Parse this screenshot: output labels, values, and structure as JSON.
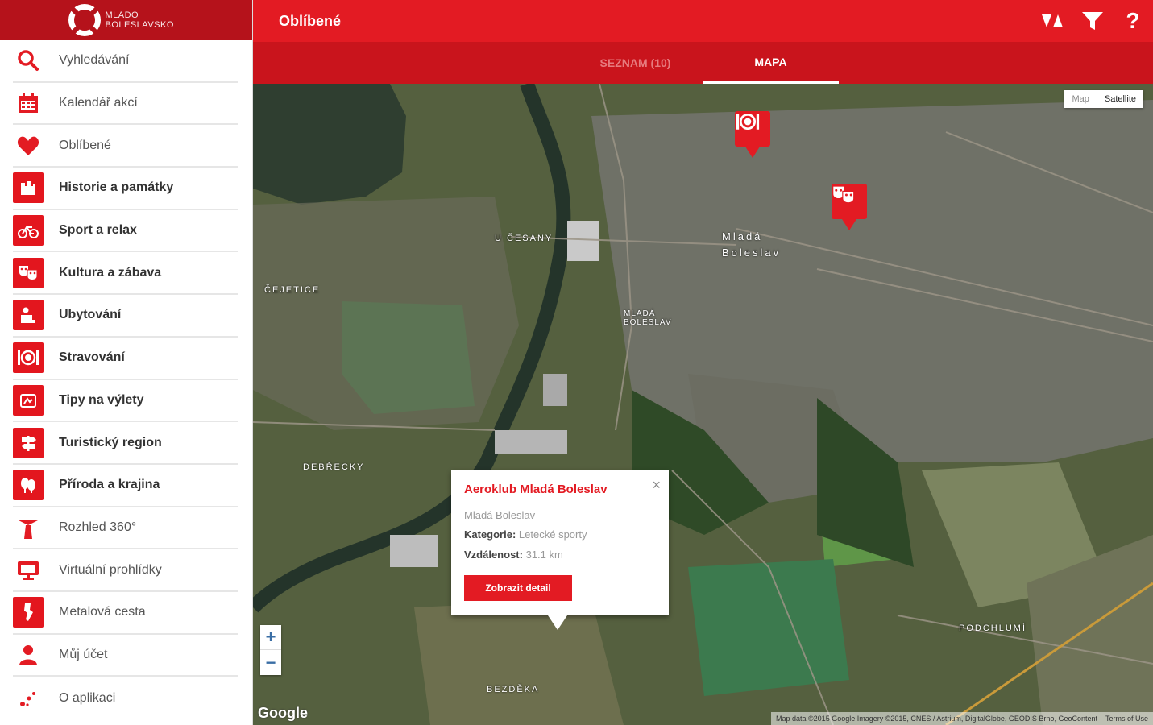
{
  "brand": {
    "name": "MLADO BOLESLAVSKO"
  },
  "header": {
    "title": "Oblíbené",
    "help_label": "?"
  },
  "tabs": [
    {
      "label": "SEZNAM (10)",
      "active": false
    },
    {
      "label": "MAPA",
      "active": true
    }
  ],
  "sidebar": {
    "items": [
      {
        "label": "Vyhledávání",
        "icon": "search-icon"
      },
      {
        "label": "Kalendář akcí",
        "icon": "calendar-icon"
      },
      {
        "label": "Oblíbené",
        "icon": "heart-icon"
      },
      {
        "label": "Historie a památky",
        "icon": "castle-icon"
      },
      {
        "label": "Sport a relax",
        "icon": "bicycle-icon"
      },
      {
        "label": "Kultura a zábava",
        "icon": "theatre-masks-icon"
      },
      {
        "label": "Ubytování",
        "icon": "hotel-icon"
      },
      {
        "label": "Stravování",
        "icon": "restaurant-icon"
      },
      {
        "label": "Tipy na výlety",
        "icon": "trip-icon"
      },
      {
        "label": "Turistický region",
        "icon": "signpost-icon"
      },
      {
        "label": "Příroda a krajina",
        "icon": "trees-icon"
      },
      {
        "label": "Rozhled 360°",
        "icon": "lookout-tower-icon"
      },
      {
        "label": "Virtuální prohlídky",
        "icon": "monitor-icon"
      },
      {
        "label": "Metalová cesta",
        "icon": "metal-path-icon"
      },
      {
        "label": "Můj účet",
        "icon": "user-icon"
      },
      {
        "label": "O aplikaci",
        "icon": "dots-icon"
      }
    ]
  },
  "map": {
    "type_map": "Map",
    "type_satellite": "Satellite",
    "zoom_in": "+",
    "zoom_out": "−",
    "google": "Google",
    "attribution": "Map data ©2015 Google Imagery ©2015, CNES / Astrium, DigitalGlobe, GEODIS Brno, GeoContent",
    "terms": "Terms of Use",
    "labels": {
      "town": "Mladá Boleslav",
      "u_cesany": "U ČESANY",
      "cejetice": "ČEJETICE",
      "podchlumi": "PODCHLUMÍ",
      "bezdeka": "BEZDĚKA",
      "debrecky": "DEBŘECKY",
      "mlada_boleslav_ii": "MLADÁ BOLESLAV"
    }
  },
  "popup": {
    "title": "Aeroklub Mladá Boleslav",
    "city": "Mladá Boleslav",
    "category_label": "Kategorie:",
    "category_value": "Letecké sporty",
    "distance_label": "Vzdálenost:",
    "distance_value": "31.1 km",
    "button_label": "Zobrazit detail",
    "close_label": "×"
  },
  "colors": {
    "accent": "#e31b23",
    "accent_dark": "#b5121b",
    "tab_bar": "#c9141c"
  }
}
